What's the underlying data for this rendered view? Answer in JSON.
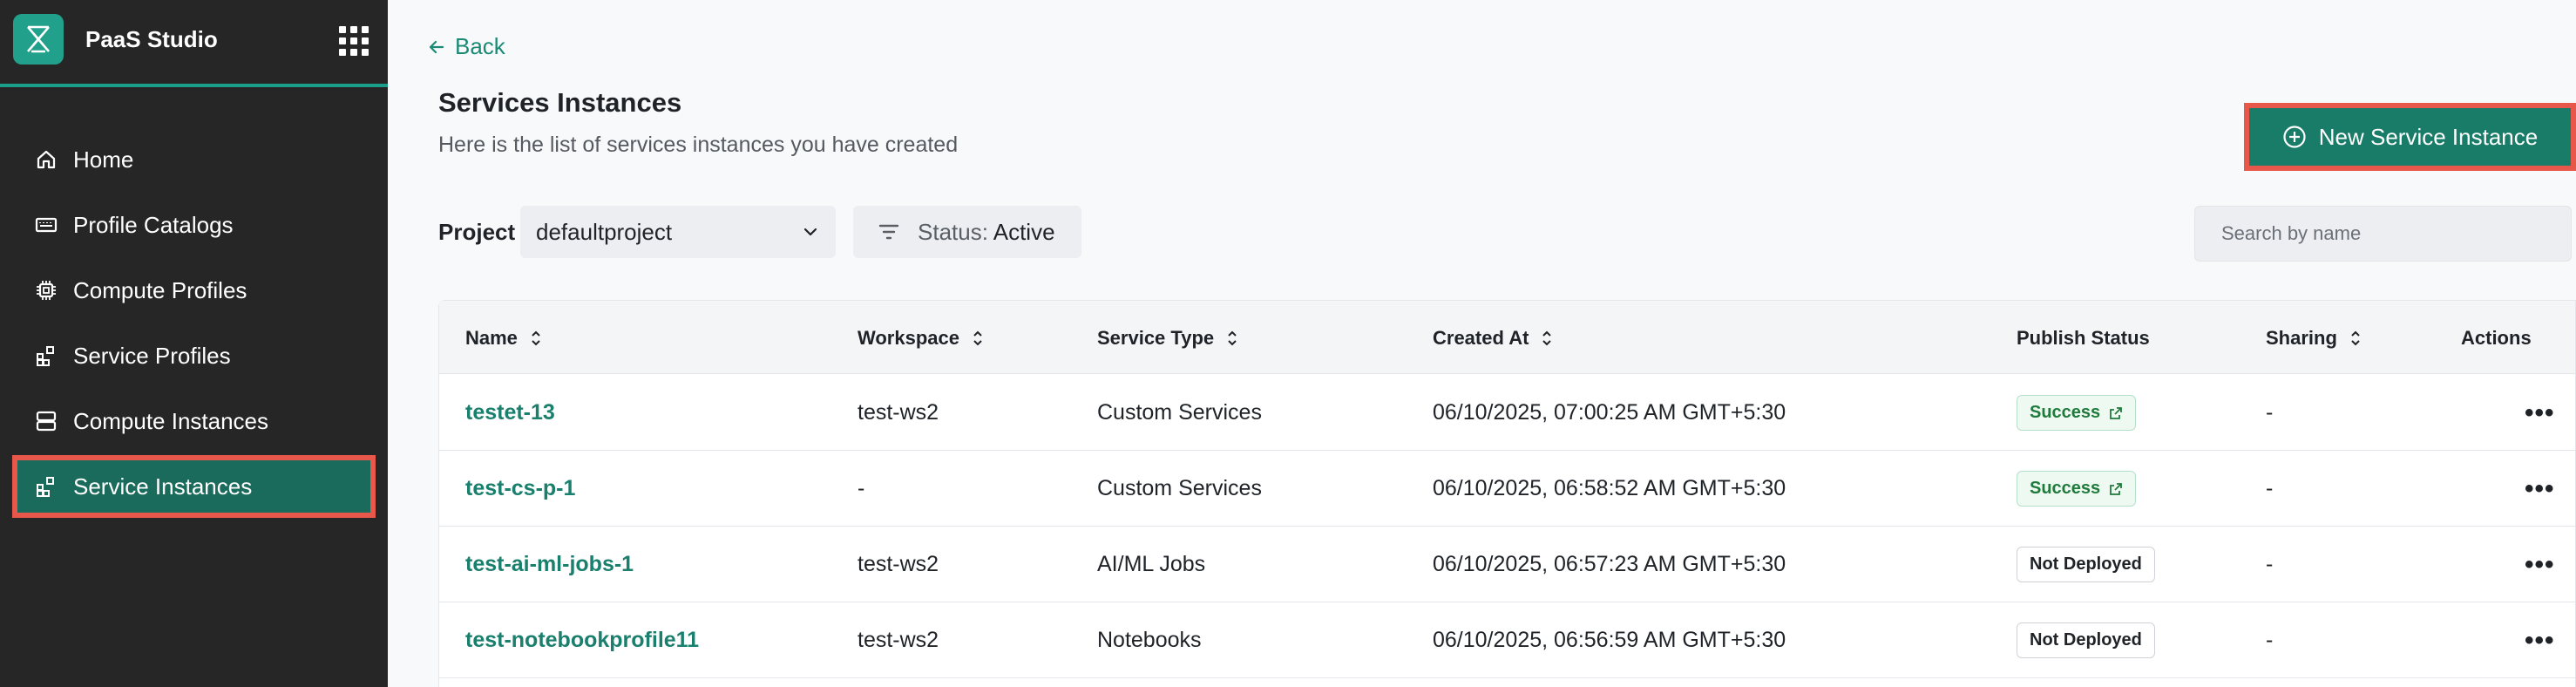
{
  "app": {
    "title": "PaaS Studio"
  },
  "sidebar": {
    "items": [
      {
        "label": "Home",
        "icon": "home-icon",
        "active": false
      },
      {
        "label": "Profile Catalogs",
        "icon": "catalog-icon",
        "active": false
      },
      {
        "label": "Compute Profiles",
        "icon": "chip-icon",
        "active": false
      },
      {
        "label": "Service Profiles",
        "icon": "blocks-icon",
        "active": false
      },
      {
        "label": "Compute Instances",
        "icon": "server-icon",
        "active": false
      },
      {
        "label": "Service Instances",
        "icon": "blocks-icon",
        "active": true
      }
    ]
  },
  "main": {
    "back_label": "Back",
    "title": "Services Instances",
    "subtitle": "Here is the list of services instances you have created",
    "new_button_label": "New Service Instance",
    "filters": {
      "project_label": "Project",
      "project_value": "defaultproject",
      "status_prefix": "Status:",
      "status_value": "Active",
      "search_placeholder": "Search by name"
    }
  },
  "table": {
    "columns": [
      "Name",
      "Workspace",
      "Service Type",
      "Created At",
      "Publish Status",
      "Sharing",
      "Actions"
    ],
    "rows": [
      {
        "name": "testet-13",
        "workspace": "test-ws2",
        "service_type": "Custom Services",
        "created_at": "06/10/2025, 07:00:25 AM GMT+5:30",
        "publish_status": "Success",
        "sharing": "-"
      },
      {
        "name": "test-cs-p-1",
        "workspace": "-",
        "service_type": "Custom Services",
        "created_at": "06/10/2025, 06:58:52 AM GMT+5:30",
        "publish_status": "Success",
        "sharing": "-"
      },
      {
        "name": "test-ai-ml-jobs-1",
        "workspace": "test-ws2",
        "service_type": "AI/ML Jobs",
        "created_at": "06/10/2025, 06:57:23 AM GMT+5:30",
        "publish_status": "Not Deployed",
        "sharing": "-"
      },
      {
        "name": "test-notebookprofile11",
        "workspace": "test-ws2",
        "service_type": "Notebooks",
        "created_at": "06/10/2025, 06:56:59 AM GMT+5:30",
        "publish_status": "Not Deployed",
        "sharing": "-"
      }
    ]
  },
  "colors": {
    "accent": "#1a8a75",
    "sidebar_bg": "#262626",
    "active_item_bg": "#1b6b5c",
    "highlight": "#e8584a",
    "success": "#1f7a3c"
  }
}
